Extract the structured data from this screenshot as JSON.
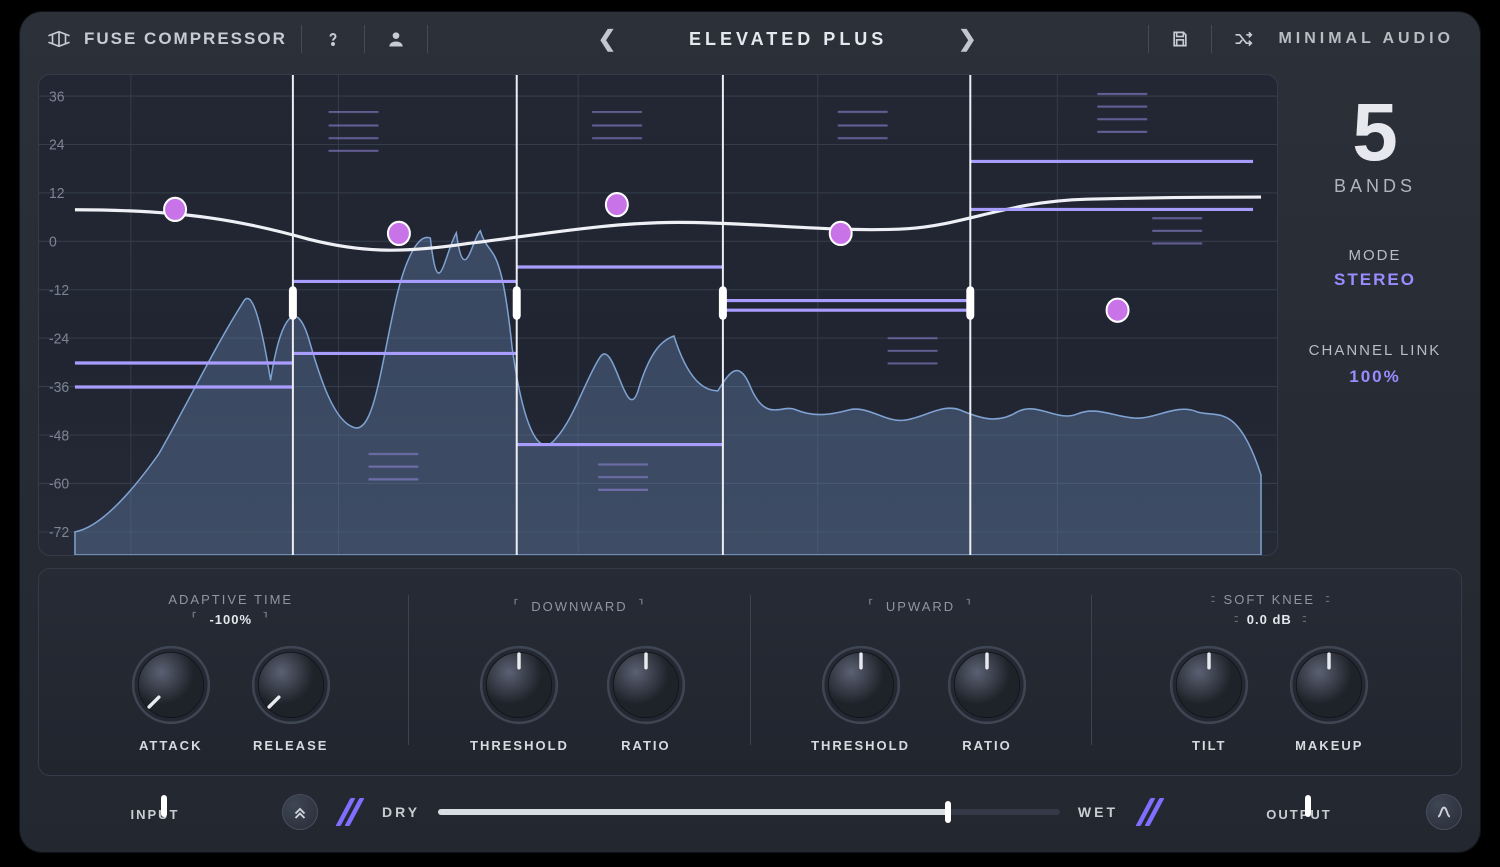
{
  "header": {
    "product_name": "FUSE COMPRESSOR",
    "brand": "MINIMAL AUDIO",
    "preset_name": "ELEVATED PLUS",
    "icons": {
      "help": "help-icon",
      "account": "account-icon",
      "prev": "chevron-left-icon",
      "next": "chevron-right-icon",
      "save": "save-icon",
      "random": "shuffle-icon"
    }
  },
  "side": {
    "bands_count": "5",
    "bands_label": "BANDS",
    "mode_label": "MODE",
    "mode_value": "STEREO",
    "link_label": "CHANNEL LINK",
    "link_value": "100%"
  },
  "analyser": {
    "y_ticks": [
      "36",
      "24",
      "12",
      "0",
      "-12",
      "-24",
      "-36",
      "-48",
      "-60",
      "-72"
    ],
    "band_splits_pct": [
      18.5,
      37.5,
      55.0,
      76.0
    ],
    "band_nodes": [
      {
        "x_pct": 8.5,
        "y_pct": 28,
        "color": "#c873e8"
      },
      {
        "x_pct": 27.5,
        "y_pct": 33,
        "color": "#c873e8"
      },
      {
        "x_pct": 46.0,
        "y_pct": 27,
        "color": "#c873e8"
      },
      {
        "x_pct": 65.0,
        "y_pct": 33,
        "color": "#c873e8"
      },
      {
        "x_pct": 88.5,
        "y_pct": 49,
        "color": "#c873e8"
      }
    ],
    "threshold_lines": [
      {
        "x1_pct": 0,
        "x2_pct": 18.5,
        "y_pct": 60,
        "color": "#a99cff"
      },
      {
        "x1_pct": 0,
        "x2_pct": 18.5,
        "y_pct": 65,
        "color": "#a99cff"
      },
      {
        "x1_pct": 18.5,
        "x2_pct": 37.5,
        "y_pct": 43,
        "color": "#a99cff"
      },
      {
        "x1_pct": 18.5,
        "x2_pct": 37.5,
        "y_pct": 58,
        "color": "#a99cff"
      },
      {
        "x1_pct": 37.5,
        "x2_pct": 55,
        "y_pct": 40,
        "color": "#a99cff"
      },
      {
        "x1_pct": 37.5,
        "x2_pct": 55,
        "y_pct": 77,
        "color": "#a99cff"
      },
      {
        "x1_pct": 55,
        "x2_pct": 76,
        "y_pct": 47,
        "color": "#a99cff"
      },
      {
        "x1_pct": 55,
        "x2_pct": 76,
        "y_pct": 49,
        "color": "#a99cff"
      },
      {
        "x1_pct": 76,
        "x2_pct": 100,
        "y_pct": 18,
        "color": "#a99cff"
      },
      {
        "x1_pct": 76,
        "x2_pct": 100,
        "y_pct": 28,
        "color": "#a99cff"
      }
    ]
  },
  "controls": {
    "adaptive": {
      "label": "ADAPTIVE TIME",
      "value": "-100%",
      "knobs": [
        {
          "label": "ATTACK",
          "angle": -135
        },
        {
          "label": "RELEASE",
          "angle": -135
        }
      ]
    },
    "downward": {
      "label": "DOWNWARD",
      "knobs": [
        {
          "label": "THRESHOLD",
          "angle": 0
        },
        {
          "label": "RATIO",
          "angle": 0
        }
      ]
    },
    "upward": {
      "label": "UPWARD",
      "knobs": [
        {
          "label": "THRESHOLD",
          "angle": 0
        },
        {
          "label": "RATIO",
          "angle": 0
        }
      ]
    },
    "right": {
      "soft_knee_label": "SOFT KNEE",
      "soft_knee_value": "0.0 dB",
      "knobs": [
        {
          "label": "TILT",
          "angle": 0
        },
        {
          "label": "MAKEUP",
          "angle": 0
        }
      ]
    }
  },
  "bottom": {
    "input_label": "INPUT",
    "dry_label": "DRY",
    "wet_label": "WET",
    "output_label": "OUTPUT",
    "input_pct": 55,
    "mix_pct": 82,
    "output_pct": 55
  }
}
